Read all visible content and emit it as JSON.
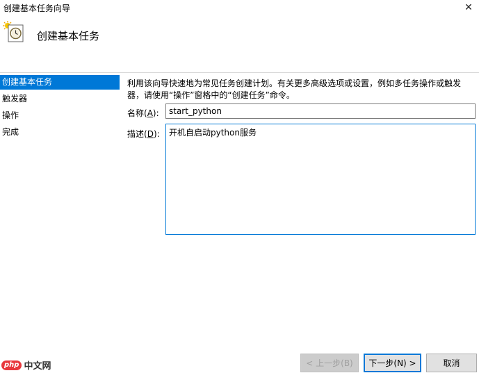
{
  "window": {
    "title": "创建基本任务向导",
    "close_glyph": "✕"
  },
  "header": {
    "title": "创建基本任务",
    "icon": "clock-task-icon"
  },
  "nav": {
    "items": [
      {
        "label": "创建基本任务",
        "active": true
      },
      {
        "label": "触发器",
        "active": false
      },
      {
        "label": "操作",
        "active": false
      },
      {
        "label": "完成",
        "active": false
      }
    ]
  },
  "main": {
    "description": "利用该向导快速地为常见任务创建计划。有关更多高级选项或设置，例如多任务操作或触发器，请使用“操作”窗格中的“创建任务”命令。",
    "name_label_pre": "名称(",
    "name_label_key": "A",
    "name_label_post": "):",
    "name_value": "start_python",
    "desc_label_pre": "描述(",
    "desc_label_key": "D",
    "desc_label_post": "):",
    "desc_value": "开机自启动python服务"
  },
  "buttons": {
    "back_label": "< 上一步(B)",
    "next_label": "下一步(N) >",
    "cancel_label": "取消"
  },
  "watermark": {
    "logo_text": "php",
    "site_text": "中文网"
  },
  "colors": {
    "accent": "#0078d7",
    "watermark_red": "#e8383d"
  }
}
